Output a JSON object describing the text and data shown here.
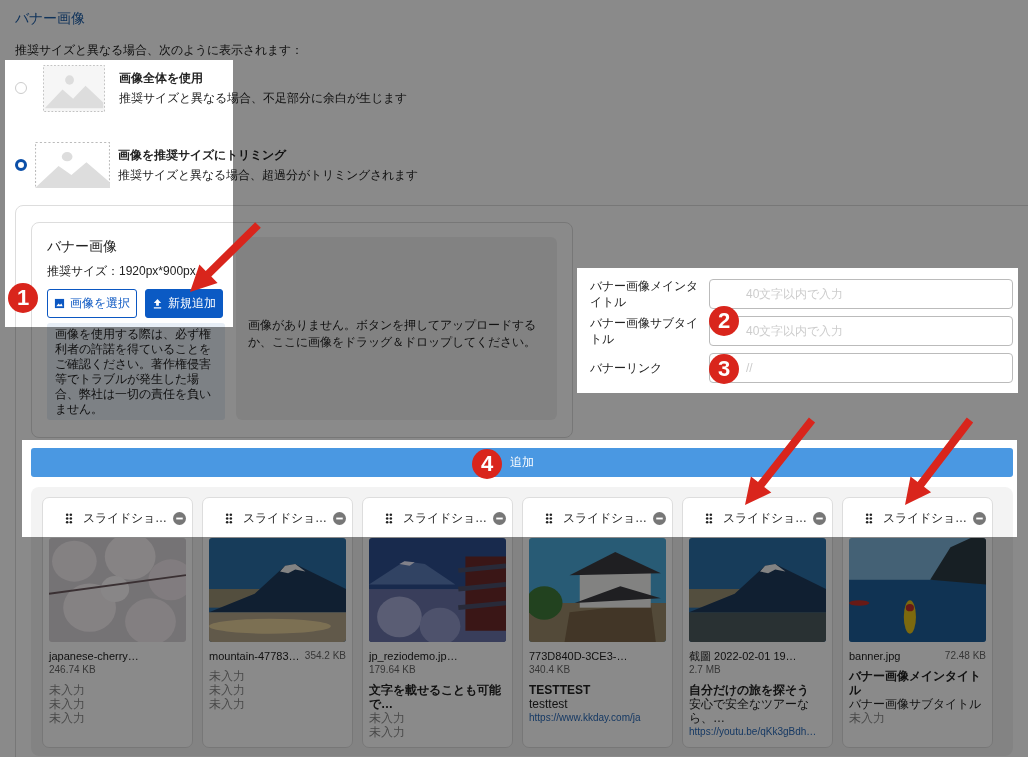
{
  "heading": "バナー画像",
  "intro": "推奨サイズと異なる場合、次のように表示されます：",
  "display_options": [
    {
      "title": "画像全体を使用",
      "description": "推奨サイズと異なる場合、不足部分に余白が生じます",
      "selected": false
    },
    {
      "title": "画像を推奨サイズにトリミング",
      "description": "推奨サイズと異なる場合、超過分がトリミングされます",
      "selected": true
    }
  ],
  "uploader": {
    "title": "バナー画像",
    "recommended_size": "推奨サイズ：1920px*900px",
    "buttons": [
      {
        "label": "画像を選択",
        "kind": "outline"
      },
      {
        "label": "新規追加",
        "kind": "filled"
      }
    ],
    "notice": "画像を使用する際は、必ず権利者の許諾を得ていることをご確認ください。著作権侵害等でトラブルが発生した場合、弊社は一切の責任を負いません。",
    "drop_zone": "画像がありません。ボタンを押してアップロードするか、ここに画像をドラッグ＆ドロップしてください。"
  },
  "fields": [
    {
      "label": "バナー画像メインタイトル",
      "placeholder": "40文字以内で入力"
    },
    {
      "label": "バナー画像サブタイトル",
      "placeholder": "40文字以内で入力"
    },
    {
      "label": "バナーリンク",
      "placeholder": "//"
    }
  ],
  "add_button": "追加",
  "slides": [
    {
      "header": "スライドショ…",
      "filename": "japanese-cherry…",
      "size": "246.74 KB",
      "lines": [
        {
          "text": "未入力",
          "kind": "empty"
        },
        {
          "text": "未入力",
          "kind": "empty"
        },
        {
          "text": "未入力",
          "kind": "empty"
        }
      ]
    },
    {
      "header": "スライドショ…",
      "filename": "mountain-47783…",
      "size": "354.2 KB",
      "lines": [
        {
          "text": "未入力",
          "kind": "empty"
        },
        {
          "text": "未入力",
          "kind": "empty"
        },
        {
          "text": "未入力",
          "kind": "empty"
        }
      ]
    },
    {
      "header": "スライドショ…",
      "filename": "jp_reziodemo.jp…",
      "size": "179.64 KB",
      "lines": [
        {
          "text": "文字を載せることも可能で…",
          "kind": "title"
        },
        {
          "text": "未入力",
          "kind": "empty"
        },
        {
          "text": "未入力",
          "kind": "empty"
        }
      ]
    },
    {
      "header": "スライドショ…",
      "filename": "773D840D-3CE3-…",
      "size": "340.4 KB",
      "lines": [
        {
          "text": "TESTTEST",
          "kind": "title"
        },
        {
          "text": "testtest",
          "kind": "subtitle"
        },
        {
          "text": "https://www.kkday.com/ja",
          "kind": "link"
        }
      ]
    },
    {
      "header": "スライドショ…",
      "filename": "截圖 2022-02-01 19…",
      "size": "2.7 MB",
      "lines": [
        {
          "text": "自分だけの旅を探そう",
          "kind": "title"
        },
        {
          "text": "安心で安全なツアーなら、…",
          "kind": "subtitle"
        },
        {
          "text": "https://youtu.be/qKk3gBdh…",
          "kind": "link"
        }
      ]
    },
    {
      "header": "スライドショ…",
      "filename": "banner.jpg",
      "size": "72.48 KB",
      "lines": [
        {
          "text": "バナー画像メインタイトル",
          "kind": "title"
        },
        {
          "text": "バナー画像サブタイトル",
          "kind": "subtitle"
        },
        {
          "text": "未入力",
          "kind": "empty"
        }
      ]
    }
  ],
  "annotations": [
    {
      "number": "1"
    },
    {
      "number": "2"
    },
    {
      "number": "3"
    },
    {
      "number": "4"
    }
  ]
}
